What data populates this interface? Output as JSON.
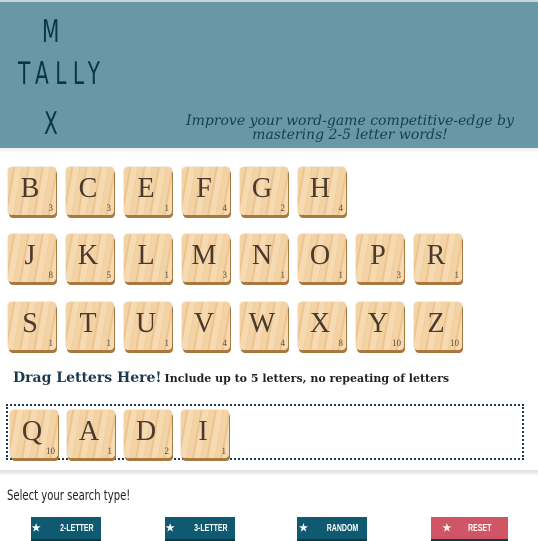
{
  "header": {
    "logo_lines": [
      "M",
      "TALLY",
      "X"
    ],
    "tagline": "Improve your word-game competitive-edge by mastering 2-5 letter words!"
  },
  "tile_rows": [
    [
      {
        "letter": "B",
        "value": "3"
      },
      {
        "letter": "C",
        "value": "3"
      },
      {
        "letter": "E",
        "value": "1"
      },
      {
        "letter": "F",
        "value": "4"
      },
      {
        "letter": "G",
        "value": "2"
      },
      {
        "letter": "H",
        "value": "4"
      }
    ],
    [
      {
        "letter": "J",
        "value": "8"
      },
      {
        "letter": "K",
        "value": "5"
      },
      {
        "letter": "L",
        "value": "1"
      },
      {
        "letter": "M",
        "value": "3"
      },
      {
        "letter": "N",
        "value": "1"
      },
      {
        "letter": "O",
        "value": "1"
      },
      {
        "letter": "P",
        "value": "3"
      },
      {
        "letter": "R",
        "value": "1"
      }
    ],
    [
      {
        "letter": "S",
        "value": "1"
      },
      {
        "letter": "T",
        "value": "1"
      },
      {
        "letter": "U",
        "value": "1"
      },
      {
        "letter": "V",
        "value": "4"
      },
      {
        "letter": "W",
        "value": "4"
      },
      {
        "letter": "X",
        "value": "8"
      },
      {
        "letter": "Y",
        "value": "10"
      },
      {
        "letter": "Z",
        "value": "10"
      }
    ]
  ],
  "drop": {
    "title": "Drag Letters Here!",
    "hint": "Include up to 5 letters, no repeating of letters",
    "tiles": [
      {
        "letter": "Q",
        "value": "10"
      },
      {
        "letter": "A",
        "value": "1"
      },
      {
        "letter": "D",
        "value": "2"
      },
      {
        "letter": "I",
        "value": "1"
      }
    ]
  },
  "search": {
    "label": "Select your search type!",
    "buttons": [
      {
        "label": "2-LETTER",
        "icon": "star-icon",
        "color": "#0f5a70"
      },
      {
        "label": "3-LETTER",
        "icon": "star-icon",
        "color": "#0f5a70"
      },
      {
        "label": "RANDOM",
        "icon": "star-icon",
        "color": "#0f5a70"
      },
      {
        "label": "RESET",
        "icon": "star-icon",
        "color": "#d05565"
      }
    ]
  }
}
